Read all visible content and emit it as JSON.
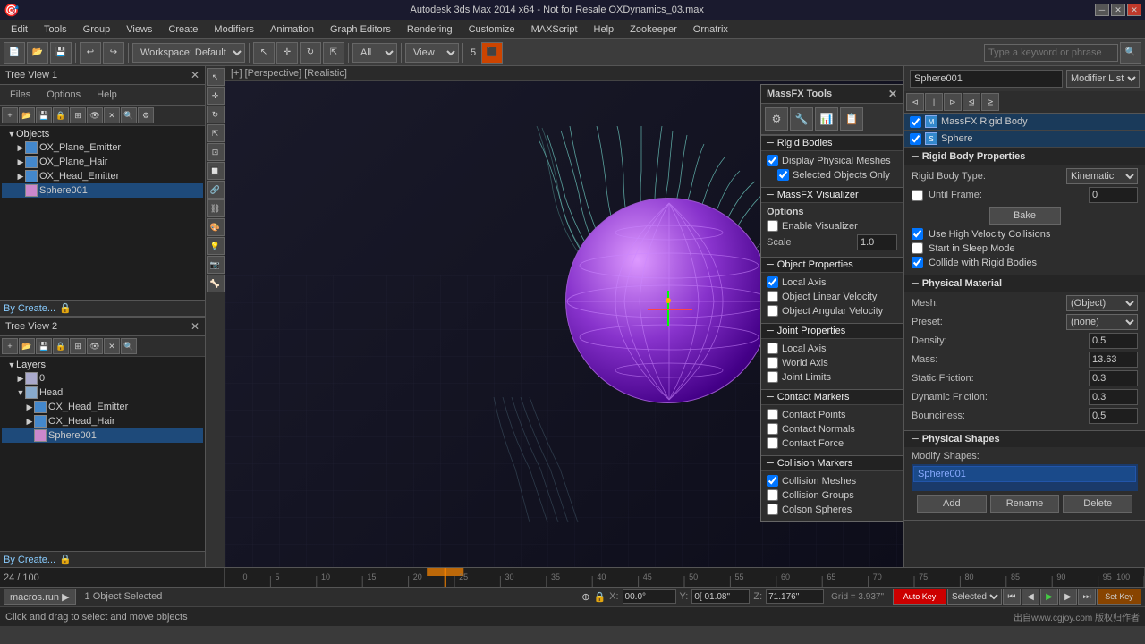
{
  "titlebar": {
    "title": "Autodesk 3ds Max 2014 x64 - Not for Resale  OXDynamics_03.max",
    "search_placeholder": "Type a keyword or phrase",
    "min_label": "─",
    "max_label": "□",
    "close_label": "✕"
  },
  "menubar": {
    "items": [
      "Edit",
      "Tools",
      "Group",
      "Views",
      "Create",
      "Modifiers",
      "Animation",
      "Graph Editors",
      "Rendering",
      "Customize",
      "MAXScript",
      "Help",
      "Zookeeper",
      "Ornatrix"
    ]
  },
  "toolbar": {
    "workspace_label": "Workspace: Default",
    "select_label": "All",
    "view_label": "View"
  },
  "left_panel": {
    "tree1_title": "Tree View 1",
    "tree2_title": "Tree View 2",
    "tabs": [
      "Files",
      "Options",
      "Help"
    ],
    "tree1_items": [
      {
        "label": "Objects",
        "level": 0,
        "type": "folder",
        "expanded": true
      },
      {
        "label": "OX_Plane_Emitter",
        "level": 1,
        "type": "blue"
      },
      {
        "label": "OX_Plane_Hair",
        "level": 1,
        "type": "blue"
      },
      {
        "label": "OX_Head_Emitter",
        "level": 1,
        "type": "blue"
      },
      {
        "label": "Sphere001",
        "level": 1,
        "type": "pink",
        "selected": true
      }
    ],
    "tree2_items": [
      {
        "label": "Layers",
        "level": 0,
        "type": "folder",
        "expanded": true
      },
      {
        "label": "0",
        "level": 1,
        "type": "layer"
      },
      {
        "label": "Head",
        "level": 1,
        "type": "folder",
        "expanded": true
      },
      {
        "label": "OX_Head_Emitter",
        "level": 2,
        "type": "blue"
      },
      {
        "label": "OX_Head_Hair",
        "level": 2,
        "type": "blue"
      },
      {
        "label": "Sphere001",
        "level": 2,
        "type": "pink",
        "selected": true
      }
    ],
    "by_create_label": "By Create...",
    "by_create2_label": "By Create..."
  },
  "viewport": {
    "label": "[+] [Perspective] [Realistic]"
  },
  "massfx": {
    "title": "MassFX Tools",
    "sections": {
      "rigid_bodies": {
        "title": "Rigid Bodies",
        "display_physical_meshes": {
          "label": "Display Physical Meshes",
          "checked": true
        },
        "selected_objects_only": {
          "label": "Selected Objects Only",
          "checked": true
        }
      },
      "visualizer": {
        "title": "MassFX Visualizer",
        "options_label": "Options",
        "enable_visualizer": {
          "label": "Enable Visualizer",
          "checked": false
        },
        "scale": {
          "label": "Scale",
          "value": "1.0"
        }
      },
      "object_properties": {
        "title": "Object Properties",
        "local_axis": {
          "label": "Local Axis",
          "checked": true
        },
        "object_linear_velocity": {
          "label": "Object Linear Velocity",
          "checked": false
        },
        "object_angular_velocity": {
          "label": "Object Angular Velocity",
          "checked": false
        }
      },
      "joint_properties": {
        "title": "Joint Properties",
        "local_axis": {
          "label": "Local Axis",
          "checked": false
        },
        "world_axis": {
          "label": "World Axis",
          "checked": false
        },
        "joint_limits": {
          "label": "Joint Limits",
          "checked": false
        }
      },
      "contact_markers": {
        "title": "Contact Markers",
        "contact_points": {
          "label": "Contact Points",
          "checked": false
        },
        "contact_normals": {
          "label": "Contact Normals",
          "checked": false
        },
        "contact_force": {
          "label": "Contact Force",
          "checked": false
        }
      },
      "collision_markers": {
        "title": "Collision Markers",
        "collision_meshes": {
          "label": "Collision Meshes",
          "checked": true
        },
        "collision_groups": {
          "label": "Collision Groups",
          "checked": false
        },
        "collision_spheres": {
          "label": "Colson Spheres",
          "checked": false
        }
      }
    }
  },
  "right_panel": {
    "object_name": "Sphere001",
    "modifier_list_label": "Modifier List",
    "modifier_entries": [
      {
        "name": "MassFX Rigid Body",
        "icon": "M"
      },
      {
        "name": "Sphere",
        "icon": "S"
      }
    ],
    "rigid_body_props": {
      "title": "Rigid Body Properties",
      "body_type_label": "Rigid Body Type:",
      "body_type_value": "Kinematic",
      "until_frame_label": "Until Frame:",
      "until_frame_value": "0",
      "bake_label": "Bake",
      "use_high_velocity": {
        "label": "Use High Velocity Collisions",
        "checked": true
      },
      "start_sleep_mode": {
        "label": "Start in Sleep Mode",
        "checked": false
      },
      "collide_rigid_bodies": {
        "label": "Collide with Rigid Bodies",
        "checked": true
      }
    },
    "physical_material": {
      "title": "Physical Material",
      "mesh_label": "Mesh:",
      "mesh_value": "(Object)",
      "preset_label": "Preset:",
      "preset_value": "(none)",
      "density_label": "Density:",
      "density_value": "0.5",
      "mass_label": "Mass:",
      "mass_value": "13.63",
      "static_friction_label": "Static Friction:",
      "static_friction_value": "0.3",
      "dynamic_friction_label": "Dynamic Friction:",
      "dynamic_friction_value": "0.3",
      "bounciness_label": "Bounciness:",
      "bounciness_value": "0.5"
    },
    "physical_shapes": {
      "title": "Physical Shapes",
      "modify_shapes_label": "Modify Shapes:",
      "shape_item": "Sphere001",
      "add_label": "Add",
      "rename_label": "Rename",
      "delete_label": "Delete"
    }
  },
  "timeline": {
    "current_frame": "24",
    "total_frames": "100",
    "ticks": [
      "0",
      "5",
      "10",
      "15",
      "20",
      "25",
      "30",
      "35",
      "40",
      "45",
      "50",
      "55",
      "60",
      "65",
      "70",
      "75",
      "80",
      "85",
      "90",
      "95",
      "100"
    ]
  },
  "statusbar": {
    "objects_selected": "1 Object Selected",
    "instruction": "Click and drag to select and move objects",
    "x_coord": "00.0°",
    "y_coord": "0[ 01.08\"",
    "z_coord": "71.176\"",
    "grid": "Grid = 3.937\"",
    "autokey_label": "Auto Key",
    "selected_label": "Selected",
    "watermark": "出自www.cgjoy.com 版权归作者"
  },
  "icons": {
    "arrow_right": "▶",
    "arrow_down": "▼",
    "minus": "─",
    "close": "✕",
    "check": "✓",
    "folder": "📁",
    "plus": "+",
    "gear": "⚙",
    "lock": "🔒",
    "play": "▶",
    "pause": "⏸",
    "stop": "⏹",
    "step_forward": "⏭",
    "step_back": "⏮",
    "key": "🔑"
  },
  "colors": {
    "accent_blue": "#1e4a7a",
    "accent_orange": "#ff8800",
    "selected_blue": "#1a4a8a",
    "header_bg": "#252525",
    "panel_bg": "#2d2d2d",
    "input_bg": "#1e1e1e"
  }
}
